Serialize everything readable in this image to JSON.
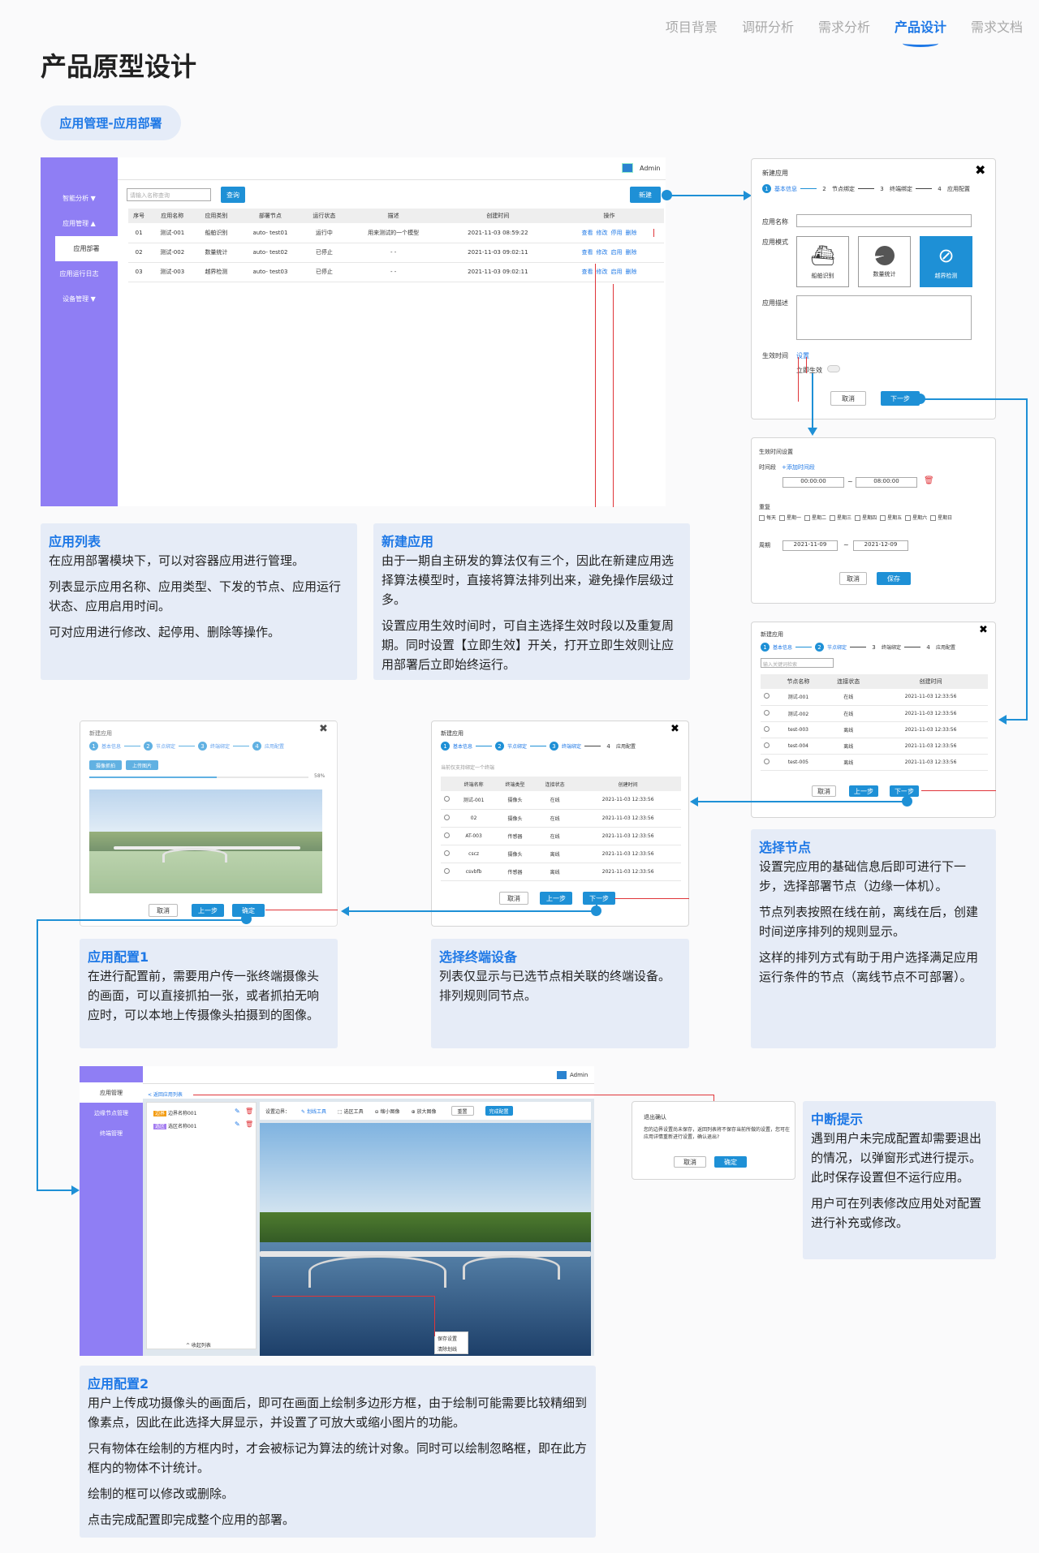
{
  "nav": [
    "项目背景",
    "调研分析",
    "需求分析",
    "产品设计",
    "需求文档"
  ],
  "page_title": "产品原型设计",
  "section_tag": "应用管理-应用部署",
  "admin": "Admin",
  "list_panel": {
    "sidebar": [
      "智能分析 ▼",
      "应用管理 ▲",
      "应用部署",
      "应用运行日志",
      "设备管理 ▼"
    ],
    "search_placeholder": "请输入名称查询",
    "search_btn": "查询",
    "new_btn": "新建",
    "headers": [
      "序号",
      "应用名称",
      "应用类别",
      "部署节点",
      "运行状态",
      "描述",
      "创建时间",
      "操作"
    ],
    "rows": [
      [
        "01",
        "测试-001",
        "船舶识别",
        "auto- test01",
        "运行中",
        "用来测试的一个模型",
        "2021-11-03 08:59:22"
      ],
      [
        "02",
        "测试-002",
        "数量统计",
        "auto- test02",
        "已停止",
        "- -",
        "2021-11-03 09:02:11"
      ],
      [
        "03",
        "测试-003",
        "越界检测",
        "auto- test03",
        "已停止",
        "- -",
        "2021-11-03 09:02:11"
      ]
    ],
    "ops": [
      [
        "查看",
        "修改",
        "停用",
        "删除"
      ],
      [
        "查看",
        "修改",
        "启用",
        "删除"
      ],
      [
        "查看",
        "修改",
        "启用",
        "删除"
      ]
    ]
  },
  "new_app_panel": {
    "title": "新建应用",
    "steps": [
      "基本信息",
      "节点绑定",
      "终端绑定",
      "应用配置"
    ],
    "name_label": "应用名称",
    "mode_label": "应用模式",
    "modes": [
      "船舶识别",
      "数量统计",
      "越界检测"
    ],
    "desc_label": "应用描述",
    "time_label": "生效时间",
    "time_link": "设置",
    "immediate_label": "立即生效",
    "cancel": "取消",
    "next": "下一步"
  },
  "time_panel": {
    "title": "生效时间设置",
    "period_label": "时间段",
    "add_period": "+添加时间段",
    "start_time": "00:00:00",
    "end_time": "08:00:00",
    "repeat_label": "重复",
    "weekdays": [
      "每天",
      "星期一",
      "星期二",
      "星期三",
      "星期四",
      "星期五",
      "星期六",
      "星期日"
    ],
    "cycle_label": "周期",
    "start_date": "2021-11-09",
    "end_date": "2021-12-09",
    "tilde": "~",
    "cancel": "取消",
    "save": "保存"
  },
  "node_panel": {
    "title": "新建应用",
    "search_placeholder": "输入关键词检索",
    "headers": [
      "节点名称",
      "连接状态",
      "创建时间"
    ],
    "rows": [
      [
        "测试-001",
        "在线",
        "2021-11-03 12:33:56"
      ],
      [
        "测试-002",
        "在线",
        "2021-11-03 12:33:56"
      ],
      [
        "test-003",
        "离线",
        "2021-11-03 12:33:56"
      ],
      [
        "test-004",
        "离线",
        "2021-11-03 12:33:56"
      ],
      [
        "test-005",
        "离线",
        "2021-11-03 12:33:56"
      ]
    ],
    "cancel": "取消",
    "prev": "上一步",
    "next": "下一步"
  },
  "terminal_panel": {
    "title": "新建应用",
    "hint": "当前仅支持绑定一个终端",
    "headers": [
      "终端名称",
      "终端类型",
      "连接状态",
      "创建时间"
    ],
    "rows": [
      [
        "测试-001",
        "摄像头",
        "在线",
        "2021-11-03 12:33:56"
      ],
      [
        "02",
        "摄像头",
        "在线",
        "2021-11-03 12:33:56"
      ],
      [
        "AT-003",
        "传感器",
        "在线",
        "2021-11-03 12:33:56"
      ],
      [
        "cscz",
        "摄像头",
        "离线",
        "2021-11-03 12:33:56"
      ],
      [
        "csvbfb",
        "传感器",
        "离线",
        "2021-11-03 12:33:56"
      ]
    ],
    "cancel": "取消",
    "prev": "上一步",
    "next": "下一步"
  },
  "config1_panel": {
    "title": "新建应用",
    "capture": "摄像抓拍",
    "upload": "上传图片",
    "progress_text": "58%",
    "progress": 0.58,
    "cancel": "取消",
    "prev": "上一步",
    "ok": "确定"
  },
  "config2_panel": {
    "sidebar": [
      "应用管理",
      "边缘节点管理",
      "终端管理"
    ],
    "back": "< 返回应用列表",
    "tags": [
      [
        "边界",
        "边界名称001"
      ],
      [
        "选区",
        "选区名称001"
      ]
    ],
    "toolbar_label": "设置边界：",
    "draw": "划线工具",
    "select": "选区工具",
    "zoom_out": "缩小图像",
    "zoom_in": "放大图像",
    "reset": "重置",
    "finish": "完成配置",
    "collapse": "^ 收起列表",
    "ctx_menu": [
      "保存设置",
      "清除划线"
    ]
  },
  "interrupt_dialog": {
    "title": "退出确认",
    "body": "您的边界设置尚未保存，返回列表将不保存当前所做的设置，您可在应用详情重新进行设置，确认退出?",
    "cancel": "取消",
    "ok": "确定"
  },
  "cards": {
    "list": {
      "title": "应用列表",
      "paras": [
        "在应用部署模块下，可以对容器应用进行管理。",
        "列表显示应用名称、应用类型、下发的节点、应用运行状态、应用启用时间。",
        "可对应用进行修改、起停用、删除等操作。"
      ]
    },
    "new_app": {
      "title": "新建应用",
      "paras": [
        "由于一期自主研发的算法仅有三个，因此在新建应用选择算法模型时，直接将算法排列出来，避免操作层级过多。",
        "设置应用生效时间时，可自主选择生效时段以及重复周期。同时设置【立即生效】开关，打开立即生效则让应用部署后立即始终运行。"
      ]
    },
    "select_node": {
      "title": "选择节点",
      "paras": [
        "设置完应用的基础信息后即可进行下一步，选择部署节点（边缘一体机）。",
        "节点列表按照在线在前，离线在后，创建时间逆序排列的规则显示。",
        "这样的排列方式有助于用户选择满足应用运行条件的节点（离线节点不可部署）。"
      ]
    },
    "terminal": {
      "title": "选择终端设备",
      "paras": [
        "列表仅显示与已选节点相关联的终端设备。排列规则同节点。"
      ]
    },
    "config1": {
      "title": "应用配置1",
      "paras": [
        "在进行配置前，需要用户传一张终端摄像头的画面，可以直接抓拍一张，或者抓拍无响应时，可以本地上传摄像头拍摄到的图像。"
      ]
    },
    "interrupt": {
      "title": "中断提示",
      "paras": [
        "遇到用户未完成配置却需要退出的情况，以弹窗形式进行提示。此时保存设置但不运行应用。",
        "用户可在列表修改应用处对配置进行补充或修改。"
      ]
    },
    "config2": {
      "title": "应用配置2",
      "paras": [
        "用户上传成功摄像头的画面后，即可在画面上绘制多边形方框，由于绘制可能需要比较精细到像素点，因此在此选择大屏显示，并设置了可放大或缩小图片的功能。",
        "只有物体在绘制的方框内时，才会被标记为算法的统计对象。同时可以绘制忽略框，即在此方框内的物体不计统计。",
        "绘制的框可以修改或删除。",
        "点击完成配置即完成整个应用的部署。"
      ]
    }
  },
  "colors": {
    "accent": "#1e90d6",
    "sidebar": "#8f7ef4",
    "card_bg": "#e6ecf7",
    "annotation_red": "#e0353a"
  }
}
